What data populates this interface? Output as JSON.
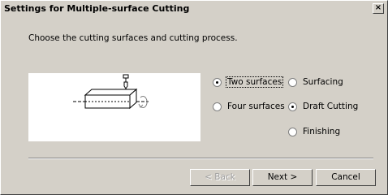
{
  "window": {
    "title": "Settings for Multiple-surface Cutting",
    "close_label": "×"
  },
  "instruction": "Choose the cutting surfaces and cutting process.",
  "surfaces": {
    "options": [
      {
        "label": "Two surfaces",
        "checked": true
      },
      {
        "label": "Four surfaces",
        "checked": false
      }
    ]
  },
  "process": {
    "options": [
      {
        "label": "Surfacing",
        "checked": false
      },
      {
        "label": "Draft Cutting",
        "checked": true
      },
      {
        "label": "Finishing",
        "checked": false
      }
    ]
  },
  "buttons": {
    "back": "< Back",
    "next": "Next >",
    "cancel": "Cancel"
  },
  "icons": {
    "illustration": "workpiece-rotation-icon"
  }
}
